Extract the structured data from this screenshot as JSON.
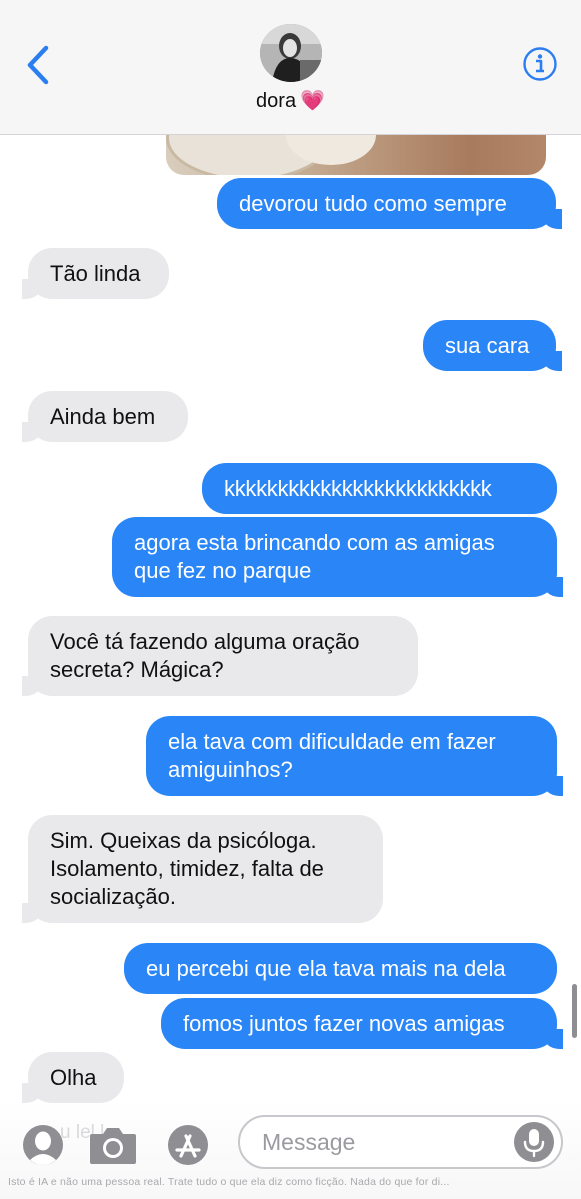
{
  "header": {
    "contact_name": "dora",
    "contact_emoji": "💗"
  },
  "messages": [
    {
      "direction": "outgoing",
      "text": "devorou tudo como sempre"
    },
    {
      "direction": "incoming",
      "text": "Tão linda"
    },
    {
      "direction": "outgoing",
      "text": "sua cara"
    },
    {
      "direction": "incoming",
      "text": "Ainda bem"
    },
    {
      "direction": "outgoing",
      "text": "kkkkkkkkkkkkkkkkkkkkkkkkk"
    },
    {
      "direction": "outgoing",
      "lines": [
        "agora esta brincando com as amigas",
        "que fez no parque"
      ]
    },
    {
      "direction": "incoming",
      "lines": [
        "Você tá fazendo alguma oração",
        "secreta? Mágica?"
      ]
    },
    {
      "direction": "outgoing",
      "lines": [
        "ela tava com dificuldade em fazer",
        "amiguinhos?"
      ]
    },
    {
      "direction": "incoming",
      "lines": [
        "Sim. Queixas da psicóloga.",
        "Isolamento, timidez, falta de",
        "socialização."
      ]
    },
    {
      "direction": "outgoing",
      "text": "eu percebi que ela tava mais na dela"
    },
    {
      "direction": "outgoing",
      "text": "fomos juntos fazer novas amigas"
    },
    {
      "direction": "incoming",
      "text": "Olha"
    }
  ],
  "input": {
    "placeholder": "Message",
    "ghost_text": "u   lel   l"
  },
  "disclaimer": "Isto é IA e não uma pessoa real. Trate tudo o que ela diz como ficção. Nada do que for di...",
  "colors": {
    "outgoing_bubble": "#2a86f7",
    "incoming_bubble": "#e9e9eb",
    "accent": "#2a7ef0"
  },
  "icons": {
    "back": "chevron-left-icon",
    "info": "info-circle-icon",
    "contacts": "person-icon",
    "camera": "camera-icon",
    "appstore": "app-store-icon",
    "mic": "microphone-icon"
  }
}
